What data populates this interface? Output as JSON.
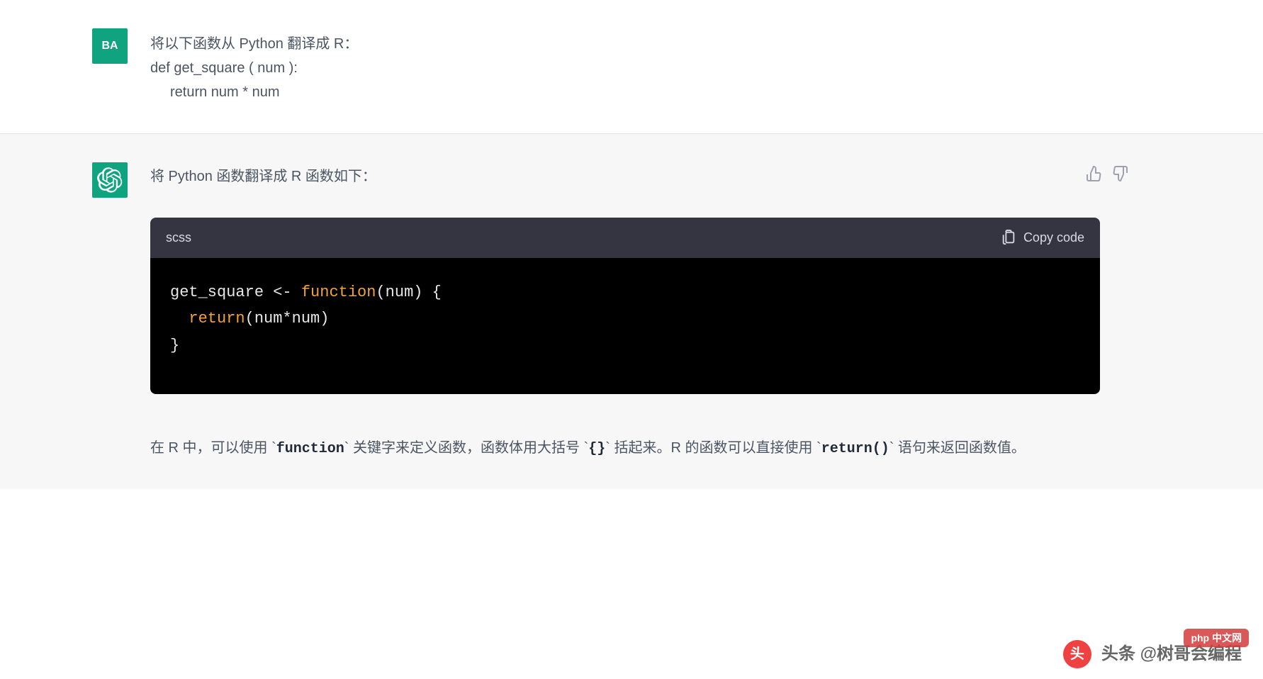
{
  "user": {
    "avatar_label": "BA",
    "message": {
      "line1": "将以下函数从 Python 翻译成 R：",
      "line2": "def  get_square ( num ):",
      "line3": "return num * num"
    }
  },
  "assistant": {
    "intro": "将 Python 函数翻译成 R 函数如下：",
    "code": {
      "language": "scss",
      "copy_label": "Copy code",
      "line1": {
        "id": "get_square",
        "op": " <- ",
        "fn": "function",
        "rest": "(num) {"
      },
      "line2": {
        "ret": "return",
        "args": "(num*num)"
      },
      "line3": "}"
    },
    "explanation": {
      "part1": "在 R 中，可以使用 `",
      "code1": "function",
      "part2": "` 关键字来定义函数，函数体用大括号 `",
      "code2": "{}",
      "part3": "` 括起来。R 的函数可以直接使用 `",
      "code3": "return()",
      "part4": "` 语句来返回函数值。"
    }
  },
  "watermark": {
    "label": "头条 @树哥会编程",
    "sub": "php 中文网"
  }
}
